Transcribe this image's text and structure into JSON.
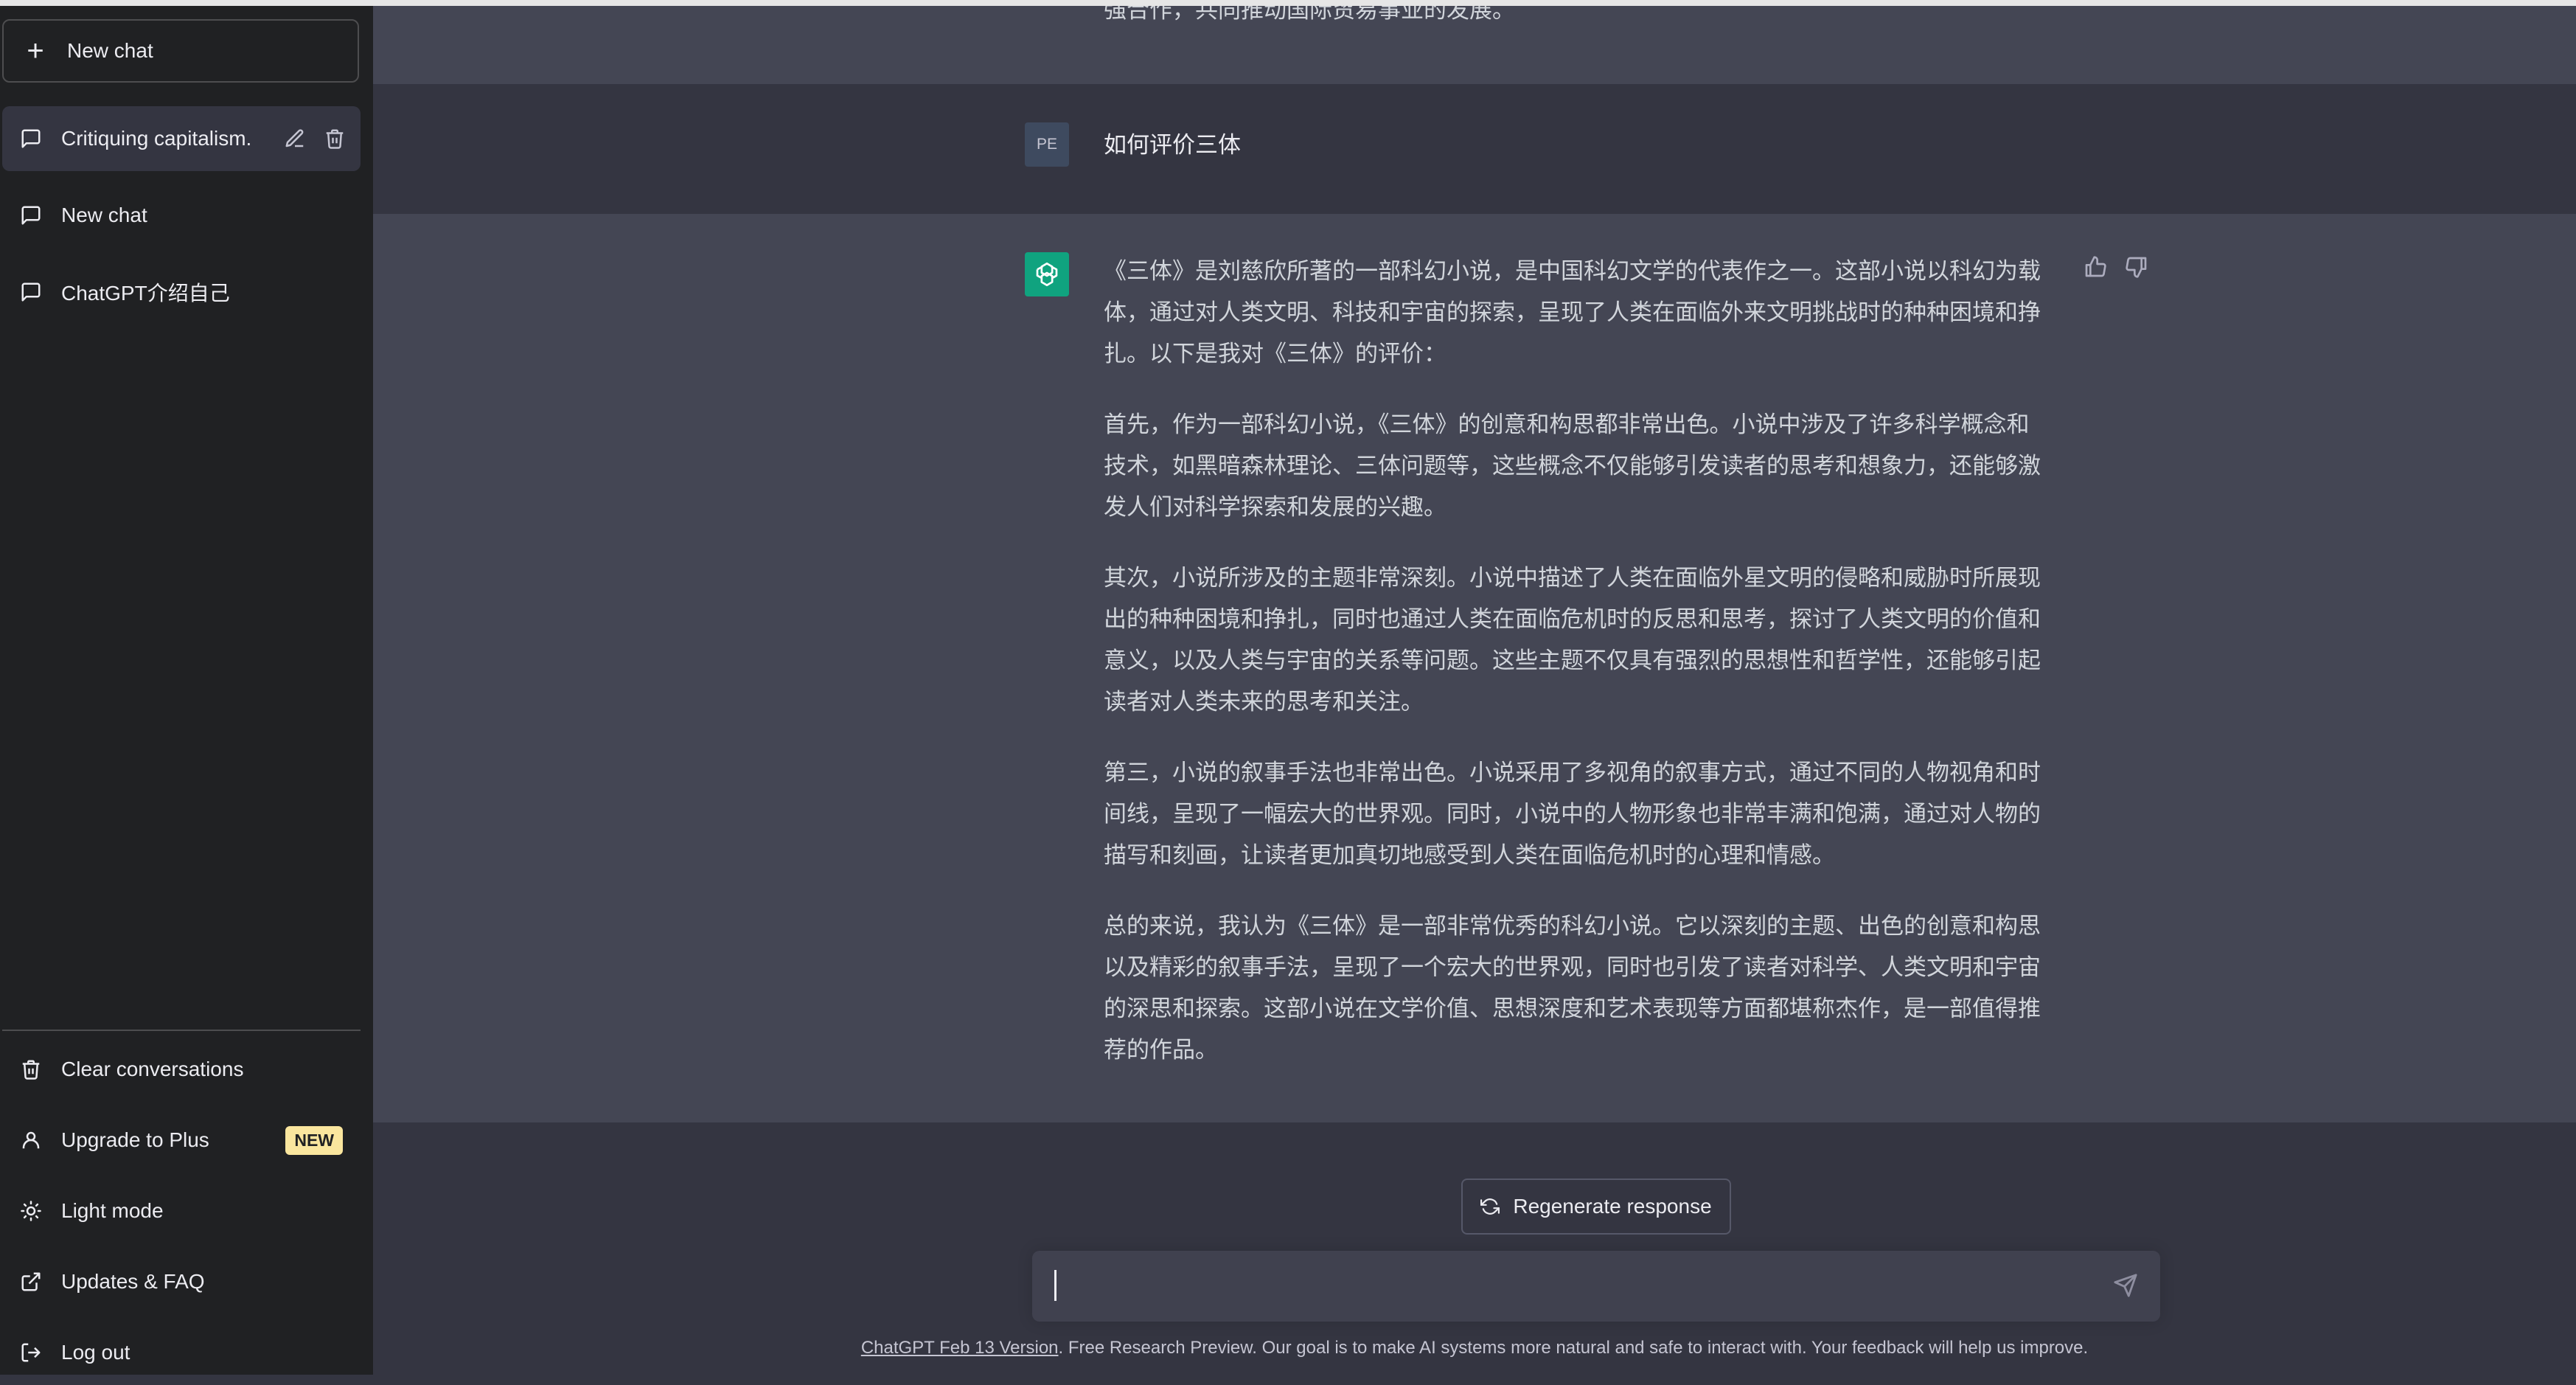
{
  "sidebar": {
    "new_chat_label": "New chat",
    "conversations": [
      {
        "label": "Critiquing capitalism.",
        "active": true
      },
      {
        "label": "New chat",
        "active": false
      },
      {
        "label": "ChatGPT介绍自己",
        "active": false
      }
    ],
    "menu": [
      {
        "label": "Clear conversations",
        "icon": "trash-icon"
      },
      {
        "label": "Upgrade to Plus",
        "icon": "user-icon",
        "badge": "NEW"
      },
      {
        "label": "Light mode",
        "icon": "sun-icon"
      },
      {
        "label": "Updates & FAQ",
        "icon": "external-link-icon"
      },
      {
        "label": "Log out",
        "icon": "logout-icon"
      }
    ]
  },
  "chat": {
    "previous_fragment": "强合作，共同推动国际贸易事业的发展。",
    "user_avatar": "PE",
    "user_message": "如何评价三体",
    "assistant_paragraphs": [
      "《三体》是刘慈欣所著的一部科幻小说，是中国科幻文学的代表作之一。这部小说以科幻为载体，通过对人类文明、科技和宇宙的探索，呈现了人类在面临外来文明挑战时的种种困境和挣扎。以下是我对《三体》的评价：",
      "首先，作为一部科幻小说，《三体》的创意和构思都非常出色。小说中涉及了许多科学概念和技术，如黑暗森林理论、三体问题等，这些概念不仅能够引发读者的思考和想象力，还能够激发人们对科学探索和发展的兴趣。",
      "其次，小说所涉及的主题非常深刻。小说中描述了人类在面临外星文明的侵略和威胁时所展现出的种种困境和挣扎，同时也通过人类在面临危机时的反思和思考，探讨了人类文明的价值和意义，以及人类与宇宙的关系等问题。这些主题不仅具有强烈的思想性和哲学性，还能够引起读者对人类未来的思考和关注。",
      "第三，小说的叙事手法也非常出色。小说采用了多视角的叙事方式，通过不同的人物视角和时间线，呈现了一幅宏大的世界观。同时，小说中的人物形象也非常丰满和饱满，通过对人物的描写和刻画，让读者更加真切地感受到人类在面临危机时的心理和情感。",
      "总的来说，我认为《三体》是一部非常优秀的科幻小说。它以深刻的主题、出色的创意和构思以及精彩的叙事手法，呈现了一个宏大的世界观，同时也引发了读者对科学、人类文明和宇宙的深思和探索。这部小说在文学价值、思想深度和艺术表现等方面都堪称杰作，是一部值得推荐的作品。"
    ]
  },
  "composer": {
    "regenerate_label": "Regenerate response",
    "input_value": "",
    "input_placeholder": ""
  },
  "footer": {
    "version_link": "ChatGPT Feb 13 Version",
    "text": ". Free Research Preview. Our goal is to make AI systems more natural and safe to interact with. Your feedback will help us improve."
  },
  "colors": {
    "sidebar_bg": "#202123",
    "main_bg": "#343541",
    "assistant_row_bg": "#444654",
    "brand_green": "#10a37f",
    "badge_yellow": "#fae69e"
  }
}
